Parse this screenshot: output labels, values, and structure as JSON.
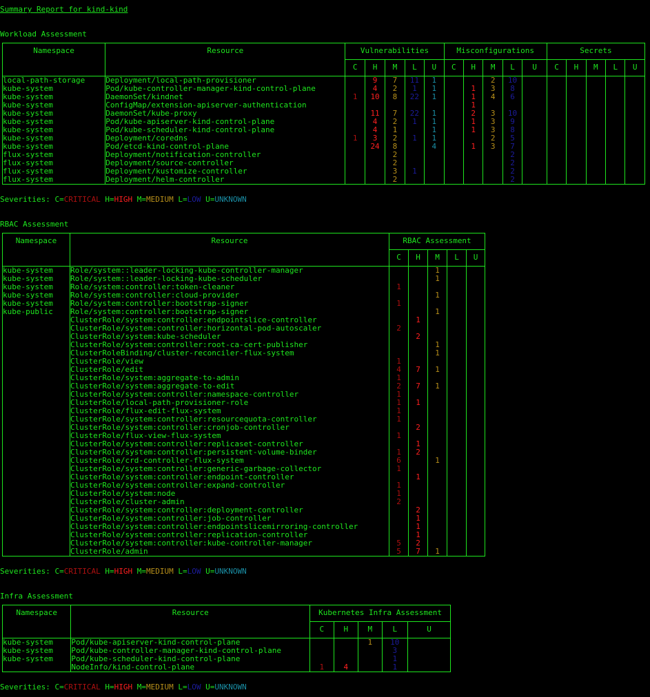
{
  "report_title": "Summary Report for kind-kind",
  "severity_legend": {
    "prefix": "Severities: ",
    "c_key": "C=",
    "c_val": "CRITICAL",
    "h_key": "H=",
    "h_val": "HIGH",
    "m_key": "M=",
    "m_val": "MEDIUM",
    "l_key": "L=",
    "l_val": "LOW",
    "u_key": "U=",
    "u_val": "UNKNOWN"
  },
  "colors": {
    "text": "#1ee61e",
    "critical": "#b01010",
    "high": "#ff2020",
    "medium": "#b8901a",
    "low": "#1c1c9c",
    "unknown": "#1a8fa6"
  },
  "workload": {
    "heading": "Workload Assessment",
    "col_namespace": "Namespace",
    "col_resource": "Resource",
    "group_vuln": "Vulnerabilities",
    "group_misconf": "Misconfigurations",
    "group_secrets": "Secrets",
    "sev_headers": [
      "C",
      "H",
      "M",
      "L",
      "U"
    ],
    "rows": [
      {
        "ns": "local-path-storage",
        "res": "Deployment/local-path-provisioner",
        "v": [
          "",
          "9",
          "7",
          "11",
          "1"
        ],
        "m": [
          "",
          "",
          "2",
          "10",
          ""
        ],
        "s": [
          "",
          "",
          "",
          "",
          ""
        ]
      },
      {
        "ns": "kube-system",
        "res": "Pod/kube-controller-manager-kind-control-plane",
        "v": [
          "",
          "4",
          "2",
          "1",
          "1"
        ],
        "m": [
          "",
          "1",
          "3",
          "8",
          ""
        ],
        "s": [
          "",
          "",
          "",
          "",
          ""
        ]
      },
      {
        "ns": "kube-system",
        "res": "DaemonSet/kindnet",
        "v": [
          "1",
          "10",
          "8",
          "22",
          "1"
        ],
        "m": [
          "",
          "1",
          "4",
          "6",
          ""
        ],
        "s": [
          "",
          "",
          "",
          "",
          ""
        ]
      },
      {
        "ns": "kube-system",
        "res": "ConfigMap/extension-apiserver-authentication",
        "v": [
          "",
          "",
          "",
          "",
          ""
        ],
        "m": [
          "",
          "1",
          "",
          "",
          ""
        ],
        "s": [
          "",
          "",
          "",
          "",
          ""
        ]
      },
      {
        "ns": "kube-system",
        "res": "DaemonSet/kube-proxy",
        "v": [
          "",
          "11",
          "7",
          "22",
          "1"
        ],
        "m": [
          "",
          "2",
          "3",
          "10",
          ""
        ],
        "s": [
          "",
          "",
          "",
          "",
          ""
        ]
      },
      {
        "ns": "kube-system",
        "res": "Pod/kube-apiserver-kind-control-plane",
        "v": [
          "",
          "4",
          "2",
          "1",
          "1"
        ],
        "m": [
          "",
          "1",
          "3",
          "9",
          ""
        ],
        "s": [
          "",
          "",
          "",
          "",
          ""
        ]
      },
      {
        "ns": "kube-system",
        "res": "Pod/kube-scheduler-kind-control-plane",
        "v": [
          "",
          "4",
          "1",
          "",
          "1"
        ],
        "m": [
          "",
          "1",
          "3",
          "8",
          ""
        ],
        "s": [
          "",
          "",
          "",
          "",
          ""
        ]
      },
      {
        "ns": "kube-system",
        "res": "Deployment/coredns",
        "v": [
          "1",
          "3",
          "2",
          "1",
          "1"
        ],
        "m": [
          "",
          "",
          "2",
          "5",
          ""
        ],
        "s": [
          "",
          "",
          "",
          "",
          ""
        ]
      },
      {
        "ns": "kube-system",
        "res": "Pod/etcd-kind-control-plane",
        "v": [
          "",
          "24",
          "8",
          "",
          "4"
        ],
        "m": [
          "",
          "1",
          "3",
          "7",
          ""
        ],
        "s": [
          "",
          "",
          "",
          "",
          ""
        ]
      },
      {
        "ns": "flux-system",
        "res": "Deployment/notification-controller",
        "v": [
          "",
          "",
          "2",
          "",
          ""
        ],
        "m": [
          "",
          "",
          "",
          "2",
          ""
        ],
        "s": [
          "",
          "",
          "",
          "",
          ""
        ]
      },
      {
        "ns": "flux-system",
        "res": "Deployment/source-controller",
        "v": [
          "",
          "",
          "2",
          "",
          ""
        ],
        "m": [
          "",
          "",
          "",
          "2",
          ""
        ],
        "s": [
          "",
          "",
          "",
          "",
          ""
        ]
      },
      {
        "ns": "flux-system",
        "res": "Deployment/kustomize-controller",
        "v": [
          "",
          "",
          "3",
          "1",
          ""
        ],
        "m": [
          "",
          "",
          "",
          "2",
          ""
        ],
        "s": [
          "",
          "",
          "",
          "",
          ""
        ]
      },
      {
        "ns": "flux-system",
        "res": "Deployment/helm-controller",
        "v": [
          "",
          "",
          "2",
          "",
          ""
        ],
        "m": [
          "",
          "",
          "",
          "2",
          ""
        ],
        "s": [
          "",
          "",
          "",
          "",
          ""
        ]
      }
    ]
  },
  "rbac": {
    "heading": "RBAC Assessment",
    "col_namespace": "Namespace",
    "col_resource": "Resource",
    "group": "RBAC Assessment",
    "sev_headers": [
      "C",
      "H",
      "M",
      "L",
      "U"
    ],
    "rows": [
      {
        "ns": "kube-system",
        "res": "Role/system::leader-locking-kube-controller-manager",
        "v": [
          "",
          "",
          "1",
          "",
          ""
        ]
      },
      {
        "ns": "kube-system",
        "res": "Role/system::leader-locking-kube-scheduler",
        "v": [
          "",
          "",
          "1",
          "",
          ""
        ]
      },
      {
        "ns": "kube-system",
        "res": "Role/system:controller:token-cleaner",
        "v": [
          "1",
          "",
          "",
          "",
          ""
        ]
      },
      {
        "ns": "kube-system",
        "res": "Role/system:controller:cloud-provider",
        "v": [
          "",
          "",
          "1",
          "",
          ""
        ]
      },
      {
        "ns": "kube-system",
        "res": "Role/system:controller:bootstrap-signer",
        "v": [
          "1",
          "",
          "",
          "",
          ""
        ]
      },
      {
        "ns": "kube-public",
        "res": "Role/system:controller:bootstrap-signer",
        "v": [
          "",
          "",
          "1",
          "",
          ""
        ]
      },
      {
        "ns": "",
        "res": "ClusterRole/system:controller:endpointslice-controller",
        "v": [
          "",
          "1",
          "",
          "",
          ""
        ]
      },
      {
        "ns": "",
        "res": "ClusterRole/system:controller:horizontal-pod-autoscaler",
        "v": [
          "2",
          "",
          "",
          "",
          ""
        ]
      },
      {
        "ns": "",
        "res": "ClusterRole/system:kube-scheduler",
        "v": [
          "",
          "2",
          "",
          "",
          ""
        ]
      },
      {
        "ns": "",
        "res": "ClusterRole/system:controller:root-ca-cert-publisher",
        "v": [
          "",
          "",
          "1",
          "",
          ""
        ]
      },
      {
        "ns": "",
        "res": "ClusterRoleBinding/cluster-reconciler-flux-system",
        "v": [
          "",
          "",
          "1",
          "",
          ""
        ]
      },
      {
        "ns": "",
        "res": "ClusterRole/view",
        "v": [
          "1",
          "",
          "",
          "",
          ""
        ]
      },
      {
        "ns": "",
        "res": "ClusterRole/edit",
        "v": [
          "4",
          "7",
          "1",
          "",
          ""
        ]
      },
      {
        "ns": "",
        "res": "ClusterRole/system:aggregate-to-admin",
        "v": [
          "1",
          "",
          "",
          "",
          ""
        ]
      },
      {
        "ns": "",
        "res": "ClusterRole/system:aggregate-to-edit",
        "v": [
          "2",
          "7",
          "1",
          "",
          ""
        ]
      },
      {
        "ns": "",
        "res": "ClusterRole/system:controller:namespace-controller",
        "v": [
          "1",
          "",
          "",
          "",
          ""
        ]
      },
      {
        "ns": "",
        "res": "ClusterRole/local-path-provisioner-role",
        "v": [
          "1",
          "1",
          "",
          "",
          ""
        ]
      },
      {
        "ns": "",
        "res": "ClusterRole/flux-edit-flux-system",
        "v": [
          "1",
          "",
          "",
          "",
          ""
        ]
      },
      {
        "ns": "",
        "res": "ClusterRole/system:controller:resourcequota-controller",
        "v": [
          "1",
          "",
          "",
          "",
          ""
        ]
      },
      {
        "ns": "",
        "res": "ClusterRole/system:controller:cronjob-controller",
        "v": [
          "",
          "2",
          "",
          "",
          ""
        ]
      },
      {
        "ns": "",
        "res": "ClusterRole/flux-view-flux-system",
        "v": [
          "1",
          "",
          "",
          "",
          ""
        ]
      },
      {
        "ns": "",
        "res": "ClusterRole/system:controller:replicaset-controller",
        "v": [
          "",
          "1",
          "",
          "",
          ""
        ]
      },
      {
        "ns": "",
        "res": "ClusterRole/system:controller:persistent-volume-binder",
        "v": [
          "1",
          "2",
          "",
          "",
          ""
        ]
      },
      {
        "ns": "",
        "res": "ClusterRole/crd-controller-flux-system",
        "v": [
          "6",
          "",
          "1",
          "",
          ""
        ]
      },
      {
        "ns": "",
        "res": "ClusterRole/system:controller:generic-garbage-collector",
        "v": [
          "1",
          "",
          "",
          "",
          ""
        ]
      },
      {
        "ns": "",
        "res": "ClusterRole/system:controller:endpoint-controller",
        "v": [
          "",
          "1",
          "",
          "",
          ""
        ]
      },
      {
        "ns": "",
        "res": "ClusterRole/system:controller:expand-controller",
        "v": [
          "1",
          "",
          "",
          "",
          ""
        ]
      },
      {
        "ns": "",
        "res": "ClusterRole/system:node",
        "v": [
          "1",
          "",
          "",
          "",
          ""
        ]
      },
      {
        "ns": "",
        "res": "ClusterRole/cluster-admin",
        "v": [
          "2",
          "",
          "",
          "",
          ""
        ]
      },
      {
        "ns": "",
        "res": "ClusterRole/system:controller:deployment-controller",
        "v": [
          "",
          "2",
          "",
          "",
          ""
        ]
      },
      {
        "ns": "",
        "res": "ClusterRole/system:controller:job-controller",
        "v": [
          "",
          "1",
          "",
          "",
          ""
        ]
      },
      {
        "ns": "",
        "res": "ClusterRole/system:controller:endpointslicemirroring-controller",
        "v": [
          "",
          "1",
          "",
          "",
          ""
        ]
      },
      {
        "ns": "",
        "res": "ClusterRole/system:controller:replication-controller",
        "v": [
          "",
          "1",
          "",
          "",
          ""
        ]
      },
      {
        "ns": "",
        "res": "ClusterRole/system:controller:kube-controller-manager",
        "v": [
          "5",
          "2",
          "",
          "",
          ""
        ]
      },
      {
        "ns": "",
        "res": "ClusterRole/admin",
        "v": [
          "5",
          "7",
          "1",
          "",
          ""
        ]
      }
    ]
  },
  "infra": {
    "heading": "Infra Assessment",
    "col_namespace": "Namespace",
    "col_resource": "Resource",
    "group": "Kubernetes Infra Assessment",
    "sev_headers": [
      "C",
      "H",
      "M",
      "L",
      "U"
    ],
    "rows": [
      {
        "ns": "kube-system",
        "res": "Pod/kube-apiserver-kind-control-plane",
        "v": [
          "",
          "",
          "1",
          "10",
          ""
        ]
      },
      {
        "ns": "kube-system",
        "res": "Pod/kube-controller-manager-kind-control-plane",
        "v": [
          "",
          "",
          "",
          "3",
          ""
        ]
      },
      {
        "ns": "kube-system",
        "res": "Pod/kube-scheduler-kind-control-plane",
        "v": [
          "",
          "",
          "",
          "1",
          ""
        ]
      },
      {
        "ns": "",
        "res": "NodeInfo/kind-control-plane",
        "v": [
          "1",
          "4",
          "",
          "1",
          ""
        ]
      }
    ]
  }
}
